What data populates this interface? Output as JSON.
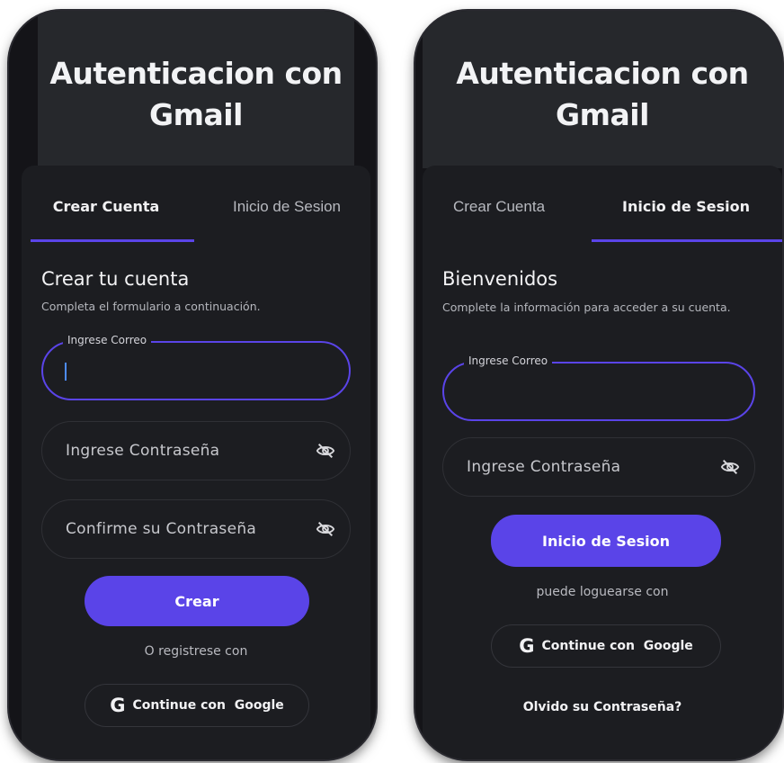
{
  "left": {
    "header_title_line1": "Autenticacion con",
    "header_title_line2": "Gmail",
    "tabs": [
      {
        "label": "Crear Cuenta",
        "active": true
      },
      {
        "label": "Inicio de Sesion",
        "active": false
      }
    ],
    "form_title": "Crear tu cuenta",
    "form_subtitle": "Completa el formulario a continuación.",
    "email_label": "Ingrese Correo",
    "password_placeholder": "Ingrese Contraseña",
    "confirm_placeholder": "Confirme su Contraseña",
    "submit_label": "Crear",
    "alt_text": "O registrese con",
    "google_label": "Continue con  Google"
  },
  "right": {
    "header_title_line1": "Autenticacion con",
    "header_title_line2": "Gmail",
    "tabs": [
      {
        "label": "Crear Cuenta",
        "active": false
      },
      {
        "label": "Inicio de Sesion",
        "active": true
      }
    ],
    "form_title": "Bienvenidos",
    "form_subtitle": "Complete la información para acceder a su cuenta.",
    "email_label": "Ingrese Correo",
    "password_placeholder": "Ingrese Contraseña",
    "submit_label": "Inicio de Sesion",
    "alt_text": "puede loguearse con",
    "google_label": "Continue con  Google",
    "forgot_label": "Olvido su Contraseña?"
  },
  "colors": {
    "accent": "#5a44e8",
    "background": "#141418",
    "card": "#1c1d21"
  },
  "icons": {
    "password_toggle": "eye-off-icon",
    "google": "google-g-icon"
  }
}
